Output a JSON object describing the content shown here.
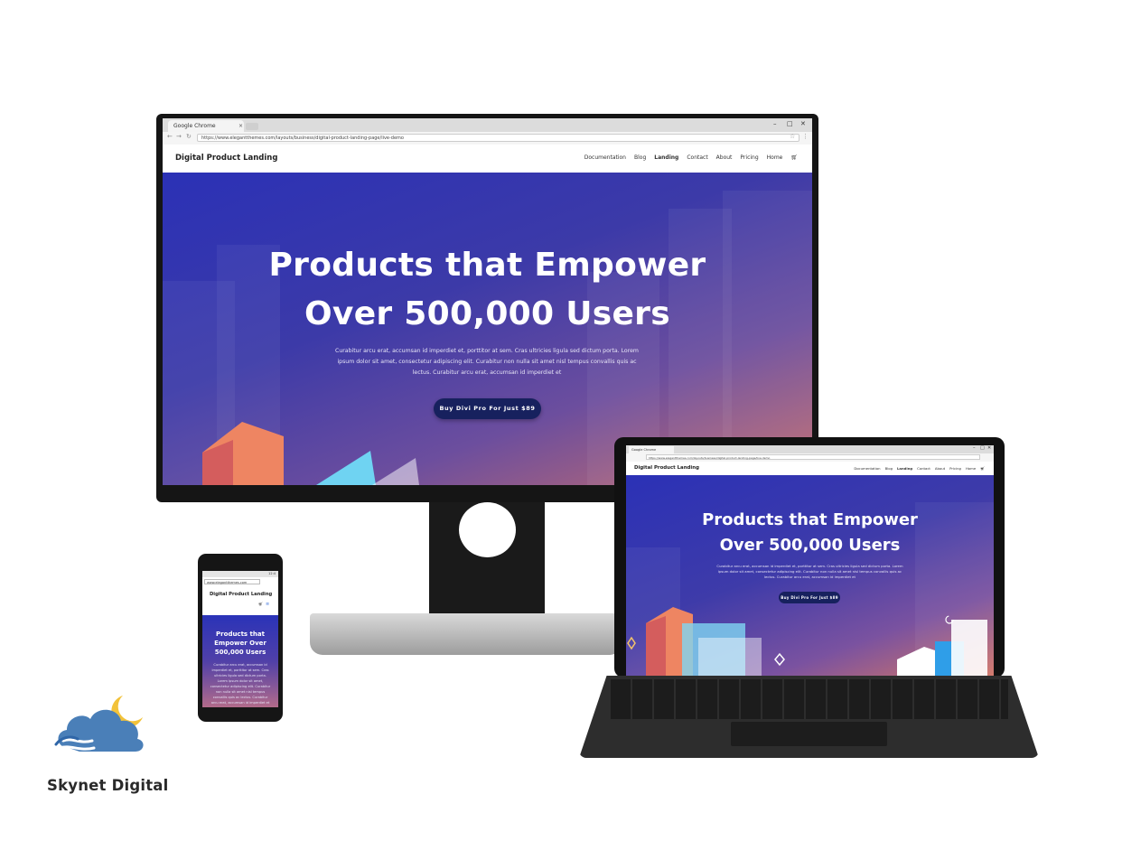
{
  "monitor": {
    "chrome": {
      "tab_title": "Google Chrome",
      "url": "https://www.elegantthemes.com/layouts/business/digital-product-landing-page/live-demo"
    },
    "site": {
      "logo": "Digital Product Landing",
      "nav": [
        "Documentation",
        "Blog",
        "Landing",
        "Contact",
        "About",
        "Pricing",
        "Home"
      ],
      "active_nav": "Landing"
    },
    "hero": {
      "title_line1": "Products that Empower",
      "title_line2": "Over 500,000 Users",
      "body": "Curabitur arcu erat, accumsan id imperdiet et, porttitor at sem. Cras ultricies ligula sed dictum porta. Lorem ipsum dolor sit amet, consectetur adipiscing elit. Curabitur non nulla sit amet nisl tempus convallis quis ac lectus. Curabitur arcu erat, accumsan id imperdiet et",
      "cta": "Buy Divi Pro For Just $89"
    }
  },
  "tablet": {
    "chrome": {
      "tab_title": "Google Chrome",
      "url": "https://www.elegantthemes.com/layouts/business/digital-product-landing-page/live-demo"
    },
    "site": {
      "logo": "Digital Product Landing",
      "nav": [
        "Documentation",
        "Blog",
        "Landing",
        "Contact",
        "About",
        "Pricing",
        "Home"
      ]
    },
    "hero": {
      "title_line1": "Products that Empower",
      "title_line2": "Over 500,000 Users",
      "body": "Curabitur arcu erat, accumsan id imperdiet et, porttitor at sem. Cras ultricies ligula sed dictum porta. Lorem ipsum dolor sit amet, consectetur adipiscing elit. Curabitur non nulla sit amet nisl tempus convallis quis ac lectus. Curabitur arcu erat, accumsan id imperdiet et",
      "cta": "Buy Divi Pro For Just $89"
    }
  },
  "phone": {
    "status": "12:4",
    "url": "www.elegantthemes.com",
    "site": {
      "logo": "Digital Product Landing"
    },
    "hero": {
      "title": "Products that Empower Over 500,000 Users",
      "body": "Curabitur arcu erat, accumsan id imperdiet et, porttitor at sem. Cras ultricies ligula sed dictum porta. Lorem ipsum dolor sit amet, consectetur adipiscing elit. Curabitur non nulla sit amet nisl tempus convallis quis ac lectus. Curabitur arcu erat, accumsan id imperdiet et"
    }
  },
  "brand": {
    "name": "Skynet Digital",
    "cloud_color": "#4a7fb8",
    "moon_color": "#f2c23a"
  },
  "colors": {
    "hero_start": "#2b31b6",
    "hero_end": "#c66d6d",
    "cta_bg": "#17215e"
  }
}
